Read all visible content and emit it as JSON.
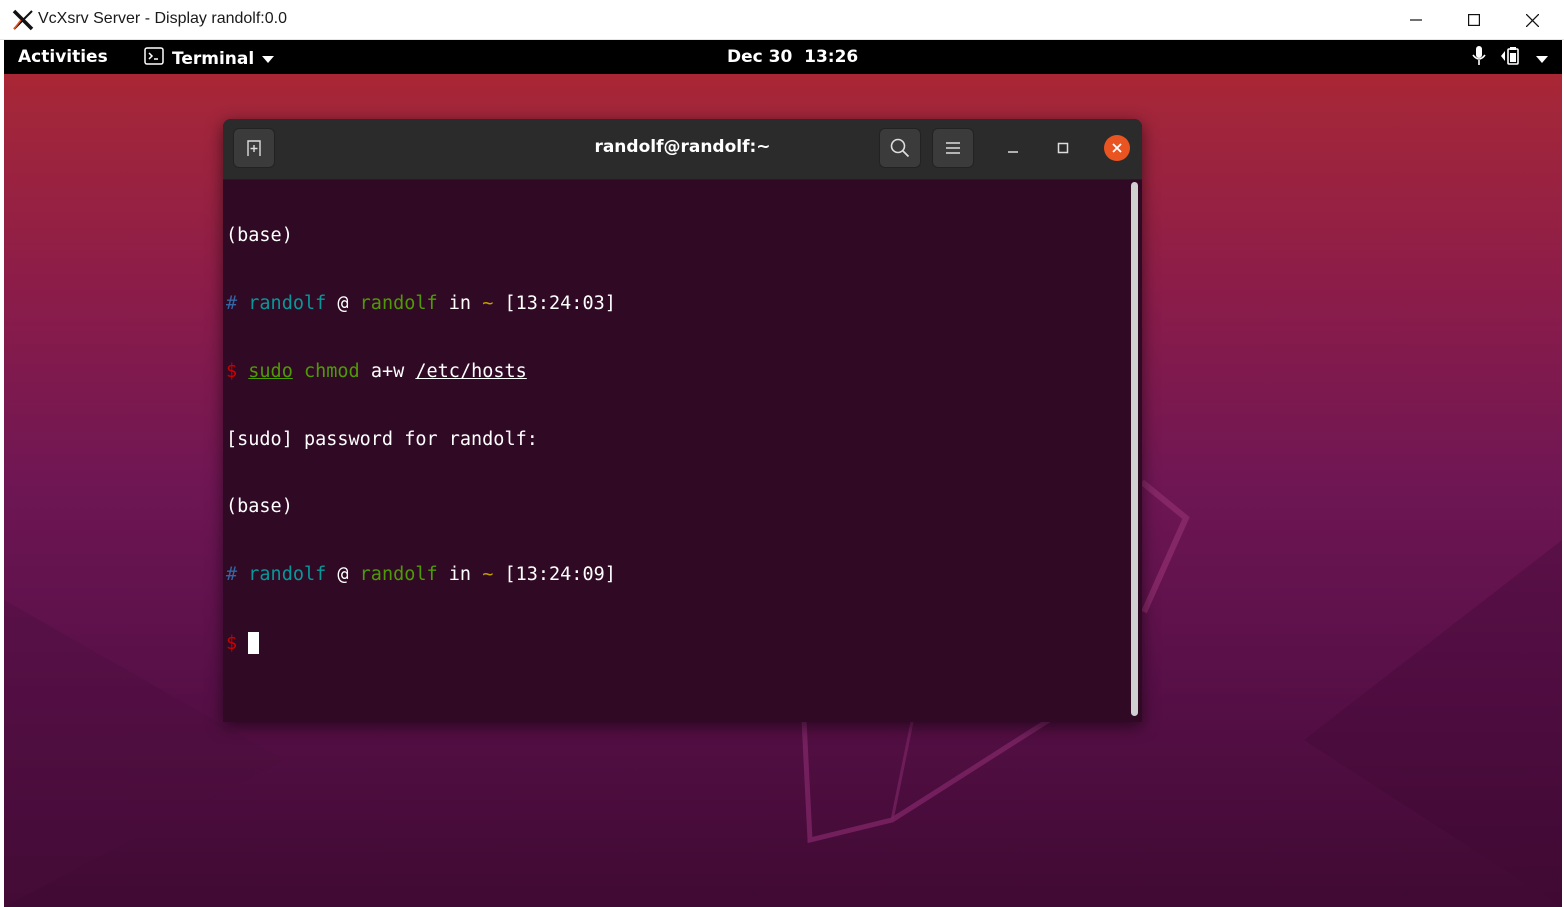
{
  "host_window": {
    "title": "VcXsrv Server - Display randolf:0.0",
    "icons": {
      "app": "x-logo-icon",
      "minimize": "minimize-icon",
      "maximize": "maximize-icon",
      "close": "close-icon"
    }
  },
  "topbar": {
    "activities": "Activities",
    "app_menu": "Terminal",
    "clock": "Dec 30  13:26",
    "icons": [
      "terminal-app-icon",
      "microphone-icon",
      "network-icon",
      "battery-icon",
      "chevron-down-icon"
    ]
  },
  "terminal": {
    "title": "randolf@randolf:~",
    "lines": {
      "l1": "(base)",
      "l2": {
        "hash": "#",
        "user": "randolf",
        "at": "@",
        "host": "randolf",
        "in": "in",
        "tilde": "~",
        "time": "[13:24:03]"
      },
      "l3": {
        "dollar": "$",
        "sudo": "sudo",
        "chmod": "chmod",
        "args": "a+w",
        "path": "/etc/hosts"
      },
      "l4": "[sudo] password for randolf:",
      "l5": "(base)",
      "l6": {
        "hash": "#",
        "user": "randolf",
        "at": "@",
        "host": "randolf",
        "in": "in",
        "tilde": "~",
        "time": "[13:24:09]"
      },
      "l7": {
        "dollar": "$"
      }
    }
  },
  "colors": {
    "terminal_bg": "#300a24",
    "header_bg": "#2b2b2b",
    "accent_close": "#e95420",
    "prompt_user": "#06989a",
    "prompt_host": "#4e9a06",
    "prompt_dollar": "#cc0000"
  }
}
